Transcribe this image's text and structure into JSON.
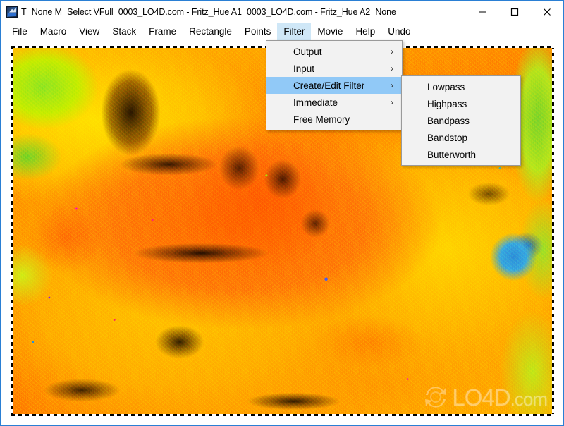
{
  "window": {
    "title": "T=None M=Select VFull=0003_LO4D.com - Fritz_Hue A1=0003_LO4D.com - Fritz_Hue A2=None",
    "app_icon": "image-editor-icon",
    "controls": {
      "minimize": "minimize-icon",
      "maximize": "maximize-icon",
      "close": "close-icon"
    },
    "accent_color": "#2a7fd4"
  },
  "menubar": {
    "items": [
      {
        "label": "File",
        "active": false
      },
      {
        "label": "Macro",
        "active": false
      },
      {
        "label": "View",
        "active": false
      },
      {
        "label": "Stack",
        "active": false
      },
      {
        "label": "Frame",
        "active": false
      },
      {
        "label": "Rectangle",
        "active": false
      },
      {
        "label": "Points",
        "active": false
      },
      {
        "label": "Filter",
        "active": true
      },
      {
        "label": "Movie",
        "active": false
      },
      {
        "label": "Help",
        "active": false
      },
      {
        "label": "Undo",
        "active": false
      }
    ],
    "highlight_color": "#cfe7f7"
  },
  "filter_menu": {
    "items": [
      {
        "label": "Output",
        "has_submenu": true,
        "selected": false,
        "arrow": "›"
      },
      {
        "label": "Input",
        "has_submenu": true,
        "selected": false,
        "arrow": "›"
      },
      {
        "label": "Create/Edit Filter",
        "has_submenu": true,
        "selected": true,
        "arrow": "›"
      },
      {
        "label": "Immediate",
        "has_submenu": true,
        "selected": false,
        "arrow": "›"
      },
      {
        "label": "Free Memory",
        "has_submenu": false,
        "selected": false,
        "arrow": ""
      }
    ],
    "selected_color": "#91c9f7",
    "background_color": "#f2f2f2"
  },
  "filter_submenu": {
    "parent": "Create/Edit Filter",
    "items": [
      {
        "label": "Lowpass"
      },
      {
        "label": "Highpass"
      },
      {
        "label": "Bandpass"
      },
      {
        "label": "Bandstop"
      },
      {
        "label": "Butterworth"
      }
    ]
  },
  "canvas": {
    "name": "image-canvas",
    "selection": "marching-ants-dashed-border",
    "description": "Hue-shifted photograph of a dog, rendered in saturated orange, yellow and red false colors with green edges and a blue patch at right"
  },
  "watermark": {
    "text": "LO4D",
    "suffix": ".com",
    "logo": "lo4d-circular-arrows-logo"
  }
}
